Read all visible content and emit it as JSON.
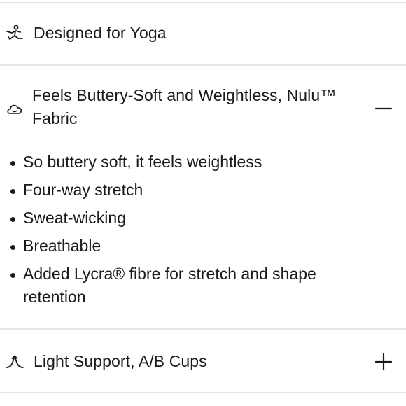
{
  "sections": [
    {
      "label": "Designed for Yoga",
      "icon": "yoga-pose-icon"
    },
    {
      "label": "Feels Buttery-Soft and Weightless, Nulu™ Fabric",
      "icon": "cloud-icon",
      "toggle": "collapse",
      "bullets": [
        "So buttery soft, it feels weightless",
        "Four-way stretch",
        "Sweat-wicking",
        "Breathable",
        "Added Lycra® fibre for stretch and shape retention"
      ]
    },
    {
      "label": "Light Support, A/B Cups",
      "icon": "light-support-icon",
      "toggle": "expand"
    }
  ]
}
